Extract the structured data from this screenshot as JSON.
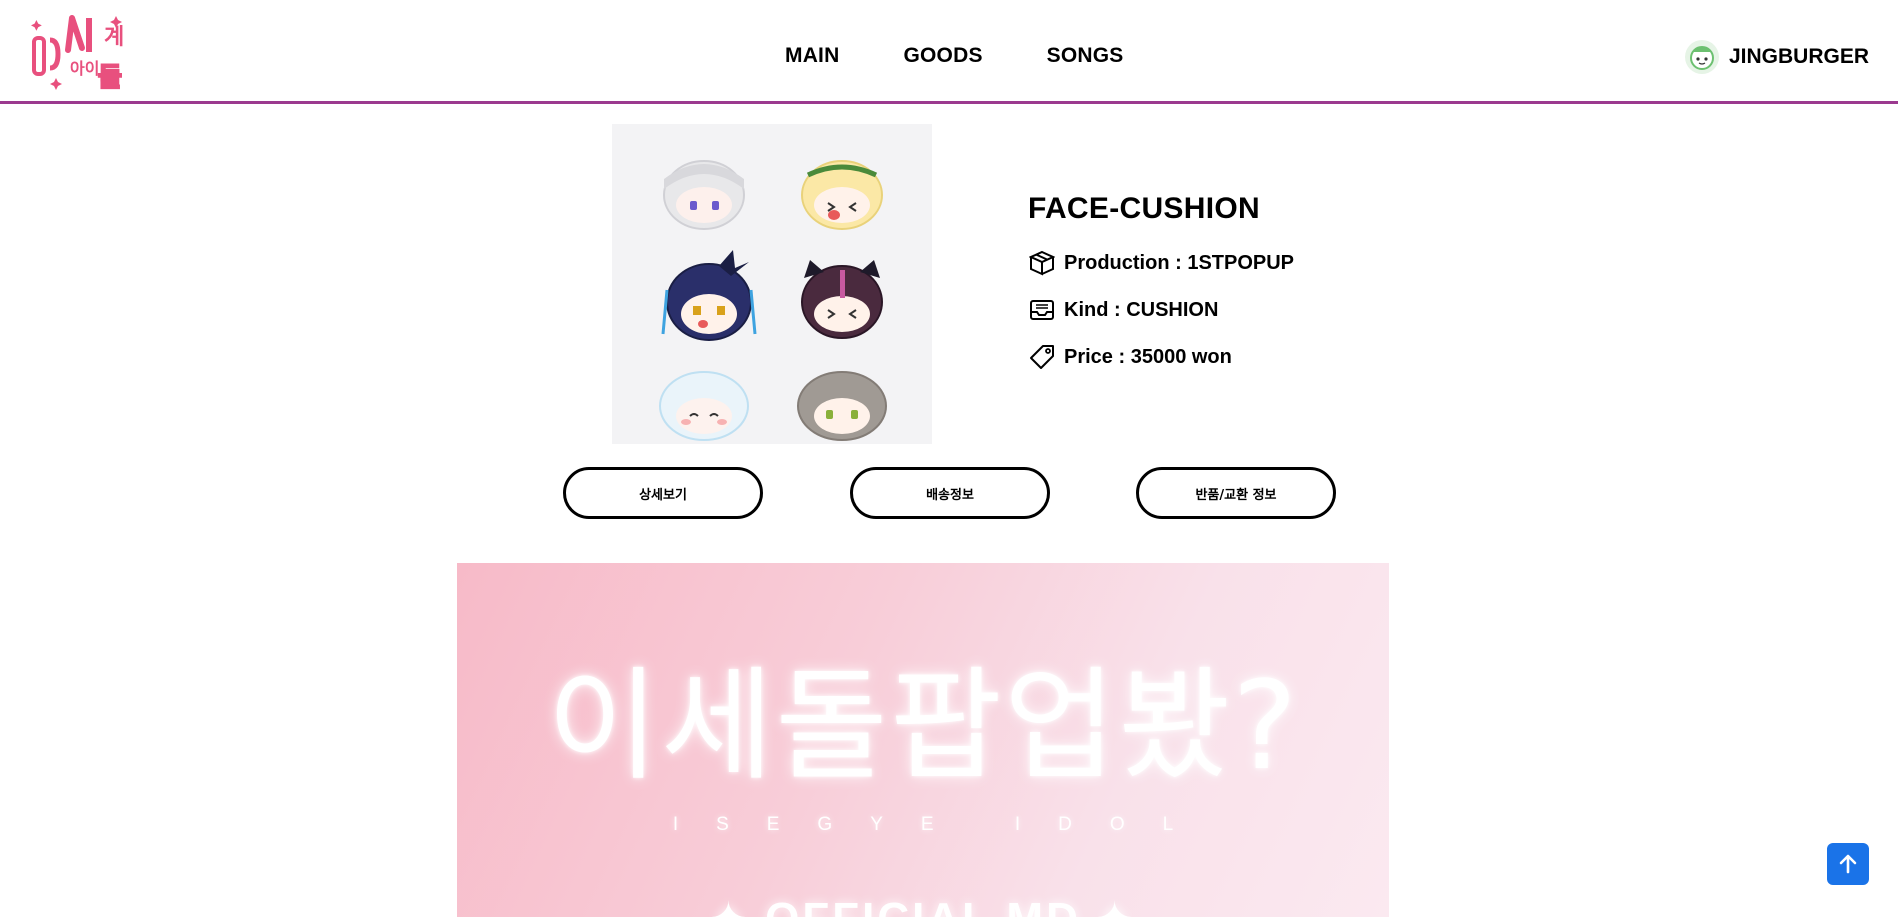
{
  "header": {
    "logo_alt": "이세계아이돌",
    "nav": [
      {
        "label": "MAIN"
      },
      {
        "label": "GOODS"
      },
      {
        "label": "SONGS"
      }
    ],
    "user": {
      "name": "JINGBURGER"
    }
  },
  "product": {
    "title": "FACE-CUSHION",
    "production": "Production : 1STPOPUP",
    "kind": "Kind : CUSHION",
    "price": "Price : 35000 won",
    "icons": [
      "box-icon",
      "tray-icon",
      "price-tag-icon"
    ]
  },
  "buttons": {
    "detail": "상세보기",
    "shipping": "배송정보",
    "returns": "반품/교환 정보"
  },
  "banner": {
    "headline": "이세돌팝업봤?",
    "subline": "ISEGYE IDOL",
    "footer_text": "✦ OFFICIAL MD ✦"
  },
  "colors": {
    "header_border": "#9b3a8f",
    "logo_pink": "#e8507e",
    "scroll_top_bg": "#1a73e8",
    "banner_pink": "#f7bac8"
  }
}
